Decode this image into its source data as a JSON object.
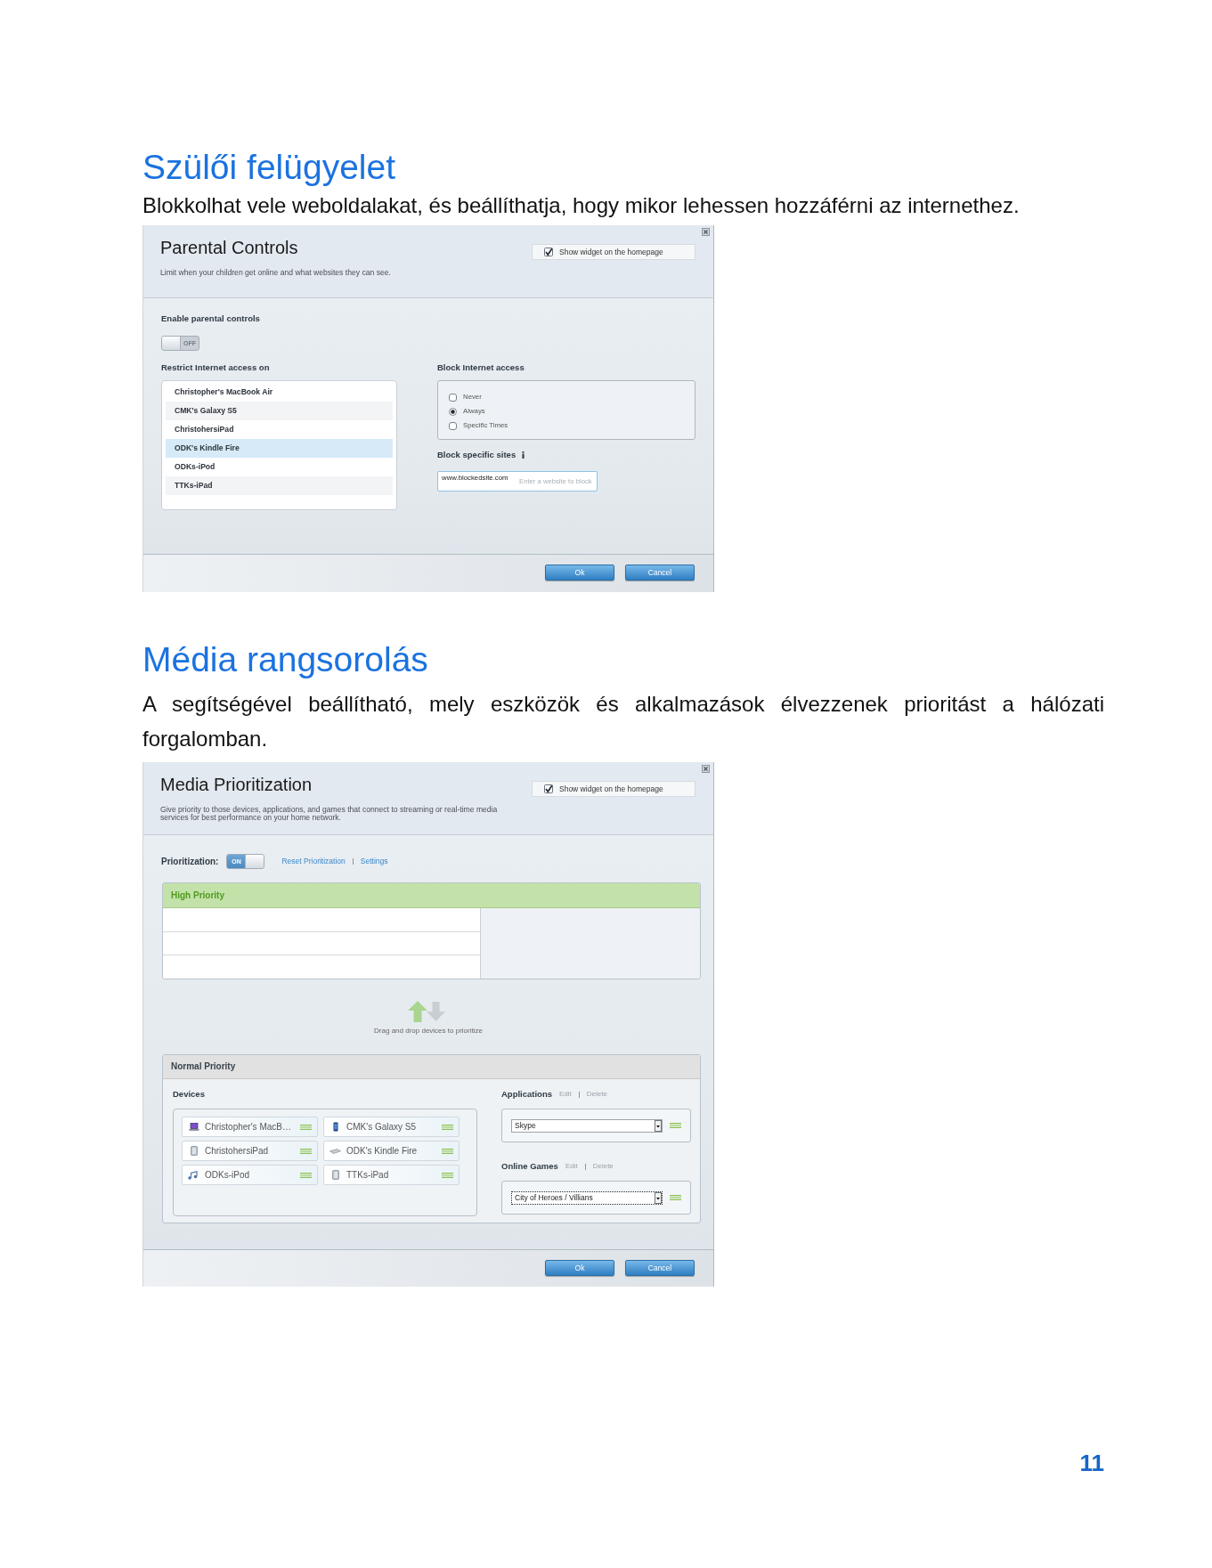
{
  "sections": [
    {
      "kind": "parental",
      "heading": "Szülői felügyelet",
      "text": "Blokkolhat vele weboldalakat, és beállíthatja, hogy mikor lehessen hozzáférni az internethez.",
      "dialog": {
        "title": "Parental Controls",
        "subtitle": "Limit when your children get online and what websites they can see.",
        "show_widget": {
          "label": "Show widget on the homepage",
          "checked": true
        },
        "enable": {
          "label": "Enable parental controls",
          "toggle": {
            "on": false,
            "label": "OFF"
          }
        },
        "restrict": {
          "label": "Restrict Internet access on",
          "devices": [
            {
              "name": "Christopher's MacBook Air",
              "selected": false
            },
            {
              "name": "CMK's Galaxy S5",
              "selected": false
            },
            {
              "name": "ChristohersiPad",
              "selected": false
            },
            {
              "name": "ODK's Kindle Fire",
              "selected": true
            },
            {
              "name": "ODKs-iPod",
              "selected": false
            },
            {
              "name": "TTKs-iPad",
              "selected": false
            }
          ]
        },
        "block_access": {
          "label": "Block Internet access",
          "options": [
            {
              "label": "Never",
              "selected": false
            },
            {
              "label": "Always",
              "selected": true
            },
            {
              "label": "Specific Times",
              "selected": false
            }
          ]
        },
        "block_sites": {
          "label": "Block specific sites",
          "field": {
            "value": "www.blockedsite.com",
            "placeholder": "Enter a website to block"
          }
        },
        "buttons": [
          "Ok",
          "Cancel"
        ]
      }
    },
    {
      "kind": "media",
      "heading": "Média rangsorolás",
      "text": "A segítségével beállítható, mely eszközök és alkalmazások élvezzenek prioritást a hálózati forgalomban.",
      "dialog": {
        "title": "Media Prioritization",
        "subtitle": "Give priority to those devices, applications, and games that connect to streaming or real-time media services for best performance on your home network.",
        "show_widget": {
          "label": "Show widget on the homepage",
          "checked": true
        },
        "prioritization": {
          "label": "Prioritization:",
          "toggle": {
            "on": true,
            "label": "ON"
          },
          "links": [
            "Reset Prioritization",
            "Settings"
          ]
        },
        "high_priority": {
          "title": "High Priority"
        },
        "drag_hint": "Drag and drop devices to prioritize",
        "normal_priority": {
          "title": "Normal Priority",
          "devices": {
            "label": "Devices",
            "items": [
              {
                "name": "Christopher's MacB…",
                "kind": "laptop"
              },
              {
                "name": "CMK's Galaxy S5",
                "kind": "phone"
              },
              {
                "name": "ChristohersiPad",
                "kind": "tablet"
              },
              {
                "name": "ODK's Kindle Fire",
                "kind": "ereader"
              },
              {
                "name": "ODKs-iPod",
                "kind": "music"
              },
              {
                "name": "TTKs-iPad",
                "kind": "tablet"
              }
            ]
          },
          "groups": [
            {
              "label": "Applications",
              "actions": [
                "Edit",
                "Delete"
              ],
              "value": "Skype",
              "focused": false
            },
            {
              "label": "Online Games",
              "actions": [
                "Edit",
                "Delete"
              ],
              "value": "City of Heroes / Villians",
              "focused": true
            }
          ]
        },
        "buttons": [
          "Ok",
          "Cancel"
        ]
      }
    }
  ],
  "page_number": "11"
}
